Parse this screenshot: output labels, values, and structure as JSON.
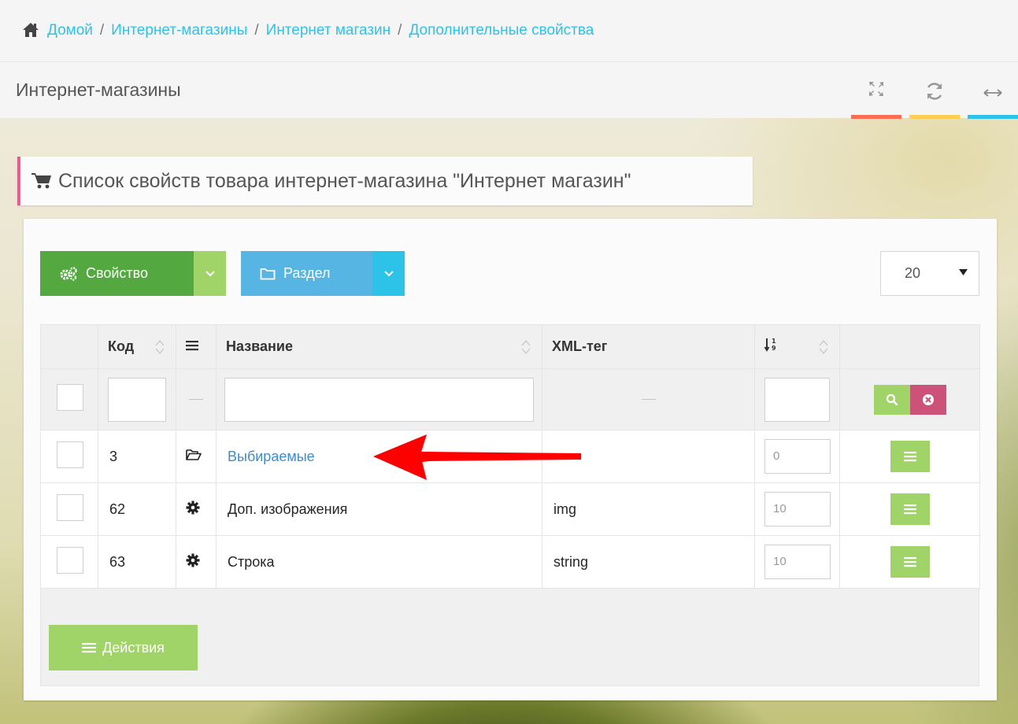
{
  "breadcrumb": {
    "items": [
      "Домой",
      "Интернет-магазины",
      "Интернет магазин",
      "Дополнительные свойства"
    ],
    "separator": "/"
  },
  "header": {
    "title": "Интернет-магазины",
    "tools": [
      {
        "icon": "expand-icon",
        "color": "#fb6e52"
      },
      {
        "icon": "refresh-icon",
        "color": "#ffce55"
      },
      {
        "icon": "collapse-icon",
        "color": "#2dc3e8"
      }
    ]
  },
  "widget": {
    "caption": "Список свойств товара интернет-магазина \"Интернет магазин\"",
    "caption_icon": "shopping-cart-icon",
    "caption_accent": "#e75b8d"
  },
  "toolbar": {
    "property_label": "Свойство",
    "section_label": "Раздел",
    "page_size": "20"
  },
  "table": {
    "columns": {
      "code": "Код",
      "name": "Название",
      "xml": "XML-тег"
    },
    "rows": [
      {
        "code": "3",
        "icon": "folder-icon",
        "name": "Выбираемые",
        "xml": "",
        "sort": "0",
        "link": true
      },
      {
        "code": "62",
        "icon": "gear-icon",
        "name": "Доп. изображения",
        "xml": "img",
        "sort": "10",
        "link": false
      },
      {
        "code": "63",
        "icon": "gear-icon",
        "name": "Строка",
        "xml": "string",
        "sort": "10",
        "link": false
      }
    ]
  },
  "footer": {
    "actions_label": "Действия"
  },
  "colors": {
    "link": "#2dc3e8",
    "green_dark": "#53a93f",
    "green_light": "#a0d468",
    "blue": "#57b5e3",
    "pink": "#cc527a",
    "arrow": "#ff0000"
  }
}
